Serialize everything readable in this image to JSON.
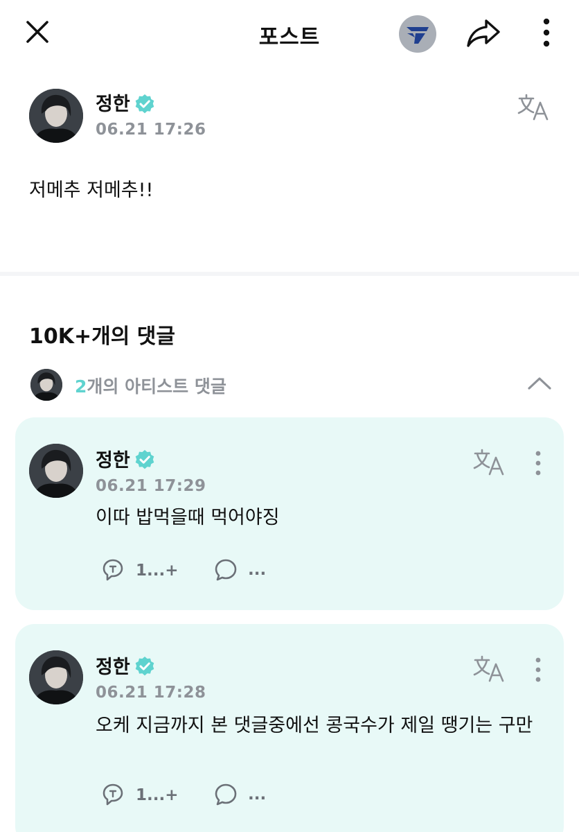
{
  "header": {
    "title": "포스트"
  },
  "post": {
    "author": "정한",
    "timestamp": "06.21 17:26",
    "body": "저메추 저메추!!"
  },
  "comments_section": {
    "count_label": "10K+개의 댓글",
    "artist_comments_count": "2",
    "artist_comments_label": "개의 아티스트 댓글"
  },
  "artist_comments": [
    {
      "author": "정한",
      "timestamp": "06.21 17:29",
      "body": "이따 밥먹을때 먹어야징",
      "like_count": "1...+",
      "reply_count": "..."
    },
    {
      "author": "정한",
      "timestamp": "06.21 17:28",
      "body": "오케 지금까지 본 댓글중에선 콩국수가 제일 땡기는 구만",
      "like_count": "1...+",
      "reply_count": "..."
    }
  ],
  "colors": {
    "accent": "#5fd3cf",
    "card_background": "#e8f9f7",
    "muted_text": "#8e9298"
  },
  "icons": [
    "close-icon",
    "brand-logo-icon",
    "share-icon",
    "more-vertical-icon",
    "verified-badge-icon",
    "translate-icon",
    "chevron-up-icon",
    "like-icon",
    "comment-icon"
  ]
}
